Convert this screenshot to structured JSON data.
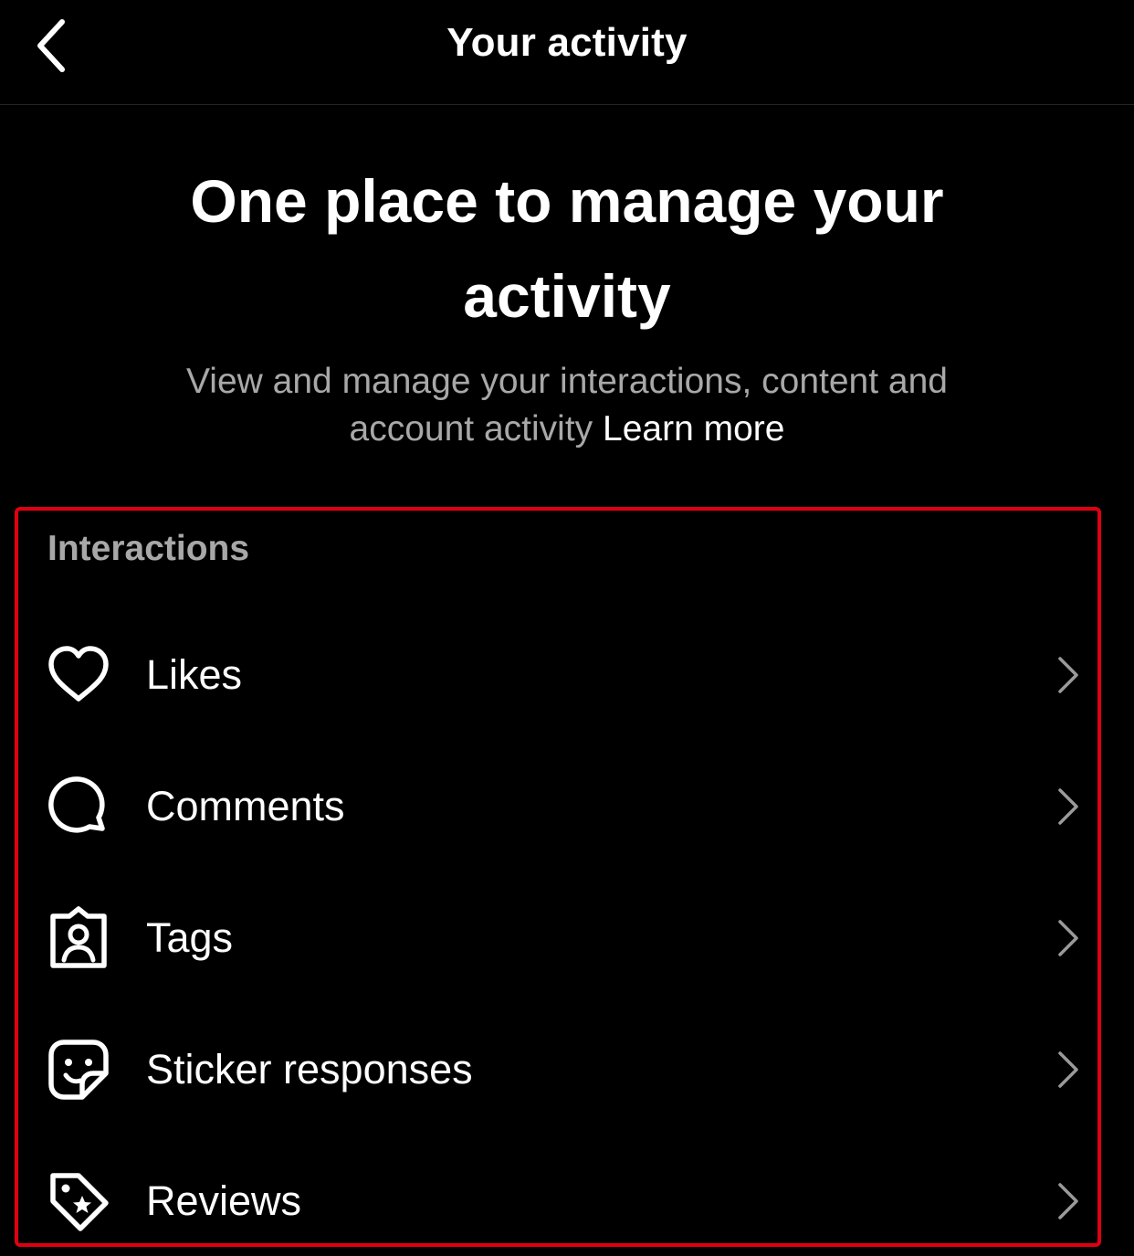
{
  "header": {
    "title": "Your activity",
    "back_icon": "chevron-left-icon"
  },
  "hero": {
    "title": "One place to manage your activity",
    "subtitle": "View and manage your interactions, content and account activity",
    "learn_more": "Learn more"
  },
  "interactions": {
    "title": "Interactions",
    "highlight_color": "#e00012",
    "items": [
      {
        "label": "Likes",
        "icon": "heart-icon"
      },
      {
        "label": "Comments",
        "icon": "comment-bubble-icon"
      },
      {
        "label": "Tags",
        "icon": "tagged-person-icon"
      },
      {
        "label": "Sticker responses",
        "icon": "sticker-icon"
      },
      {
        "label": "Reviews",
        "icon": "star-tag-icon"
      }
    ]
  },
  "colors": {
    "background": "#000000",
    "text_primary": "#ffffff",
    "text_secondary": "#a8a8a8"
  }
}
